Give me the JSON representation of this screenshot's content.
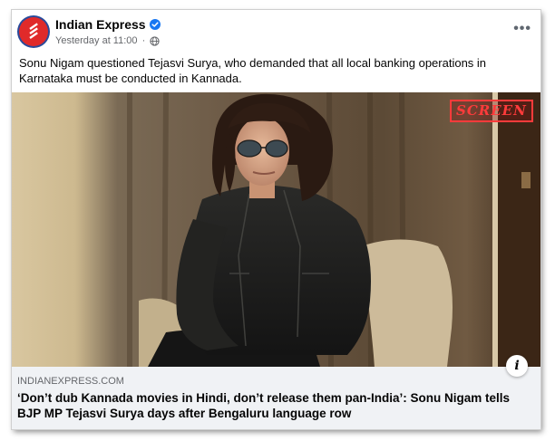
{
  "post": {
    "page_name": "Indian Express",
    "timestamp": "Yesterday at 11:00",
    "meta_separator": " · ",
    "audience_icon": "globe-icon",
    "verified_icon": "verified-badge-icon",
    "more_label": "•••",
    "caption": "Sonu Nigam questioned Tejasvi Surya, who demanded that all local banking operations in Karnataka must be conducted in Kannada."
  },
  "media": {
    "watermark": "SCREEN",
    "watermark_color": "#ff3b3b"
  },
  "link_preview": {
    "domain": "INDIANEXPRESS.COM",
    "headline": "‘Don’t dub Kannada movies in Hindi, don’t release them pan-India’: Sonu Nigam tells BJP MP Tejasvi Surya days after Bengaluru language row",
    "info_label": "i"
  },
  "colors": {
    "brand_red": "#e02a2a",
    "verified_blue": "#1877f2",
    "footer_bg": "#f0f2f5",
    "secondary_text": "#65676b"
  }
}
